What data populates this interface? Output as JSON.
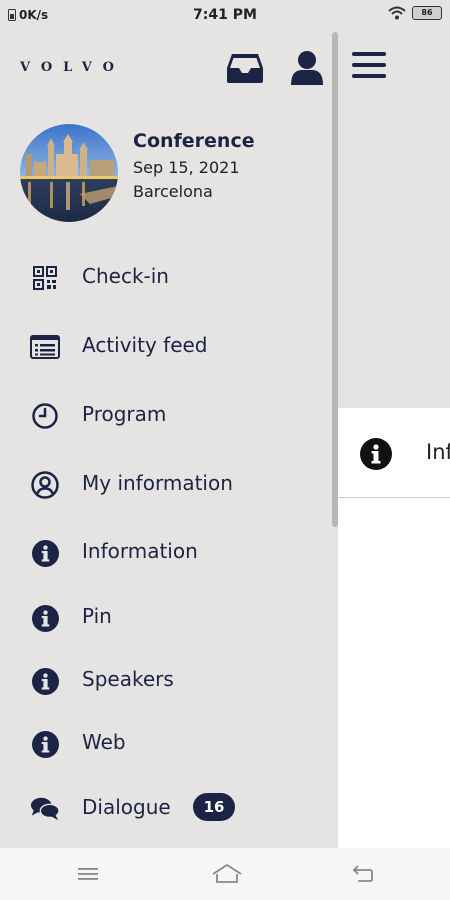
{
  "status_bar": {
    "speed": "0K/s",
    "time": "7:41 PM",
    "battery": "86"
  },
  "drawer": {
    "logo": "VOLVO",
    "event": {
      "title": "Conference",
      "date": "Sep 15, 2021",
      "city": "Barcelona"
    },
    "menu": [
      {
        "label": "Check-in",
        "icon": "qr-code-icon"
      },
      {
        "label": "Activity feed",
        "icon": "feed-list-icon"
      },
      {
        "label": "Program",
        "icon": "clock-icon"
      },
      {
        "label": "My information",
        "icon": "user-circle-icon"
      },
      {
        "label": "Information",
        "icon": "info-icon"
      },
      {
        "label": "Pin",
        "icon": "info-icon"
      },
      {
        "label": "Speakers",
        "icon": "info-icon"
      },
      {
        "label": "Web",
        "icon": "info-icon"
      },
      {
        "label": "Dialogue",
        "icon": "chat-icon",
        "badge": "16"
      }
    ]
  },
  "main": {
    "info_row_label": "Information"
  },
  "colors": {
    "accent": "#1c2446",
    "drawer_bg": "#e5e4e2",
    "content_bg": "#ffffff"
  }
}
